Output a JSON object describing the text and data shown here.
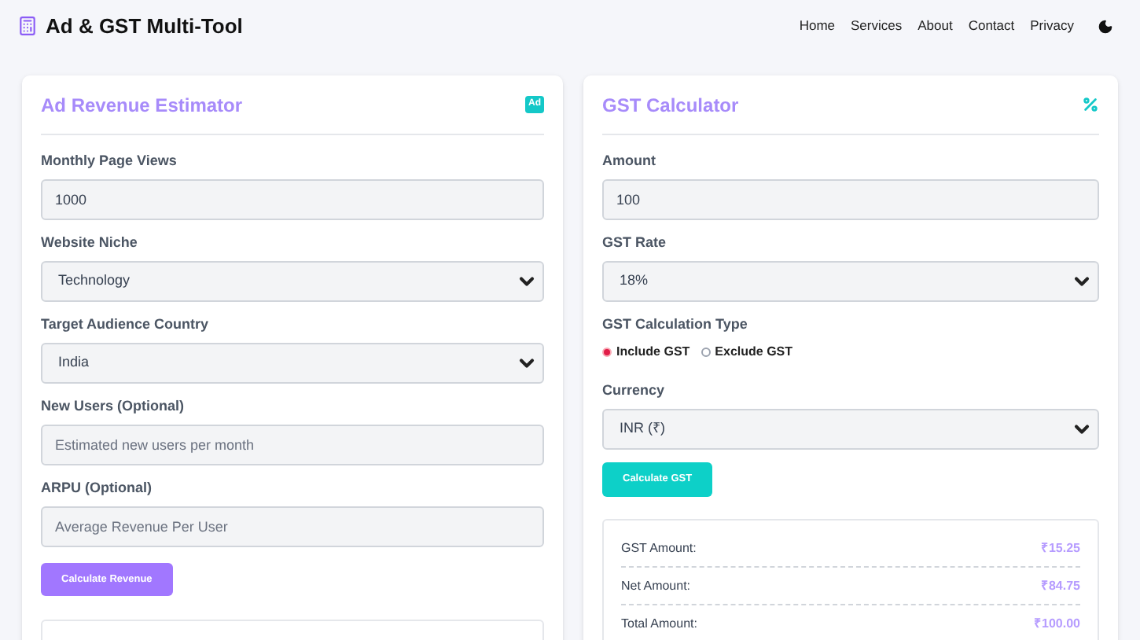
{
  "brand": {
    "title": "Ad & GST Multi-Tool"
  },
  "nav": [
    {
      "label": "Home"
    },
    {
      "label": "Services"
    },
    {
      "label": "About"
    },
    {
      "label": "Contact"
    },
    {
      "label": "Privacy"
    }
  ],
  "ad_card": {
    "title": "Ad Revenue Estimator",
    "badge": "Ad",
    "fields": [
      {
        "label": "Monthly Page Views",
        "kind": "input",
        "value": "1000"
      },
      {
        "label": "Website Niche",
        "kind": "select",
        "value": "Technology"
      },
      {
        "label": "Target Audience Country",
        "kind": "select",
        "value": "India"
      },
      {
        "label": "New Users (Optional)",
        "kind": "input",
        "placeholder": "Estimated new users per month"
      },
      {
        "label": "ARPU (Optional)",
        "kind": "input",
        "placeholder": "Average Revenue Per User"
      }
    ],
    "button": "Calculate Revenue"
  },
  "gst_card": {
    "title": "GST Calculator",
    "amount": {
      "label": "Amount",
      "value": "100"
    },
    "rate": {
      "label": "GST Rate",
      "value": "18%"
    },
    "type": {
      "label": "GST Calculation Type",
      "options": [
        {
          "label": "Include GST",
          "selected": true
        },
        {
          "label": "Exclude GST",
          "selected": false
        }
      ]
    },
    "currency": {
      "label": "Currency",
      "value": "INR (₹)"
    },
    "button": "Calculate GST",
    "results": [
      {
        "label": "GST Amount:",
        "value": "₹15.25"
      },
      {
        "label": "Net Amount:",
        "value": "₹84.75"
      },
      {
        "label": "Total Amount:",
        "value": "₹100.00"
      }
    ]
  }
}
